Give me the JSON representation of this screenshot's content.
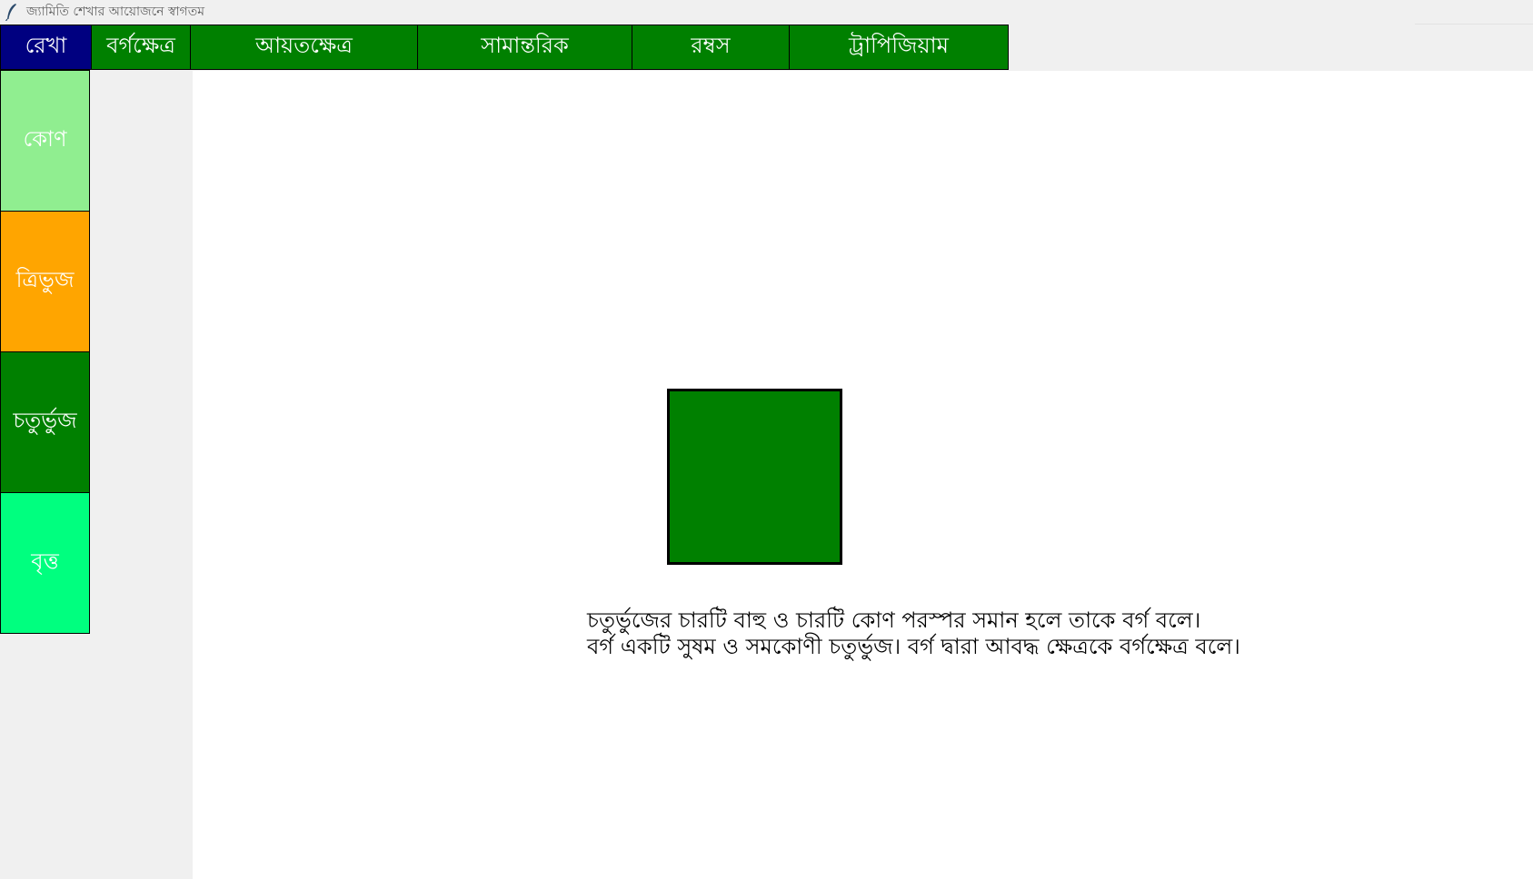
{
  "window": {
    "title": "জ্যামিতি শেখার আয়োজনে স্বাগতম",
    "icon": "feather-icon"
  },
  "top_tabs": [
    {
      "label": "রেখা",
      "color": "#000080"
    },
    {
      "label": "বর্গক্ষেত্র",
      "color": "#008000"
    },
    {
      "label": "আয়তক্ষেত্র",
      "color": "#008000"
    },
    {
      "label": "সামান্তরিক",
      "color": "#008000"
    },
    {
      "label": "রম্বস",
      "color": "#008000"
    },
    {
      "label": "ট্রাপিজিয়াম",
      "color": "#008000"
    }
  ],
  "side_items": [
    {
      "label": "কোণ",
      "color": "#90ee90"
    },
    {
      "label": "ত্রিভুজ",
      "color": "#ffa500"
    },
    {
      "label": "চতুর্ভুজ",
      "color": "#008000"
    },
    {
      "label": "বৃত্ত",
      "color": "#00ff7f"
    }
  ],
  "canvas": {
    "background": "#ffffff",
    "shape": {
      "type": "square",
      "fill": "#008000",
      "outline": "#000000"
    },
    "description": {
      "line1": "চতুর্ভুজের চারটি বাহু ও চারটি কোণ পরস্পর সমান হলে তাকে বর্গ বলে।",
      "line2": "বর্গ একটি সুষম ও সমকোণী চতুর্ভুজ। বর্গ দ্বারা আবদ্ধ ক্ষেত্রকে বর্গক্ষেত্র বলে।"
    }
  }
}
